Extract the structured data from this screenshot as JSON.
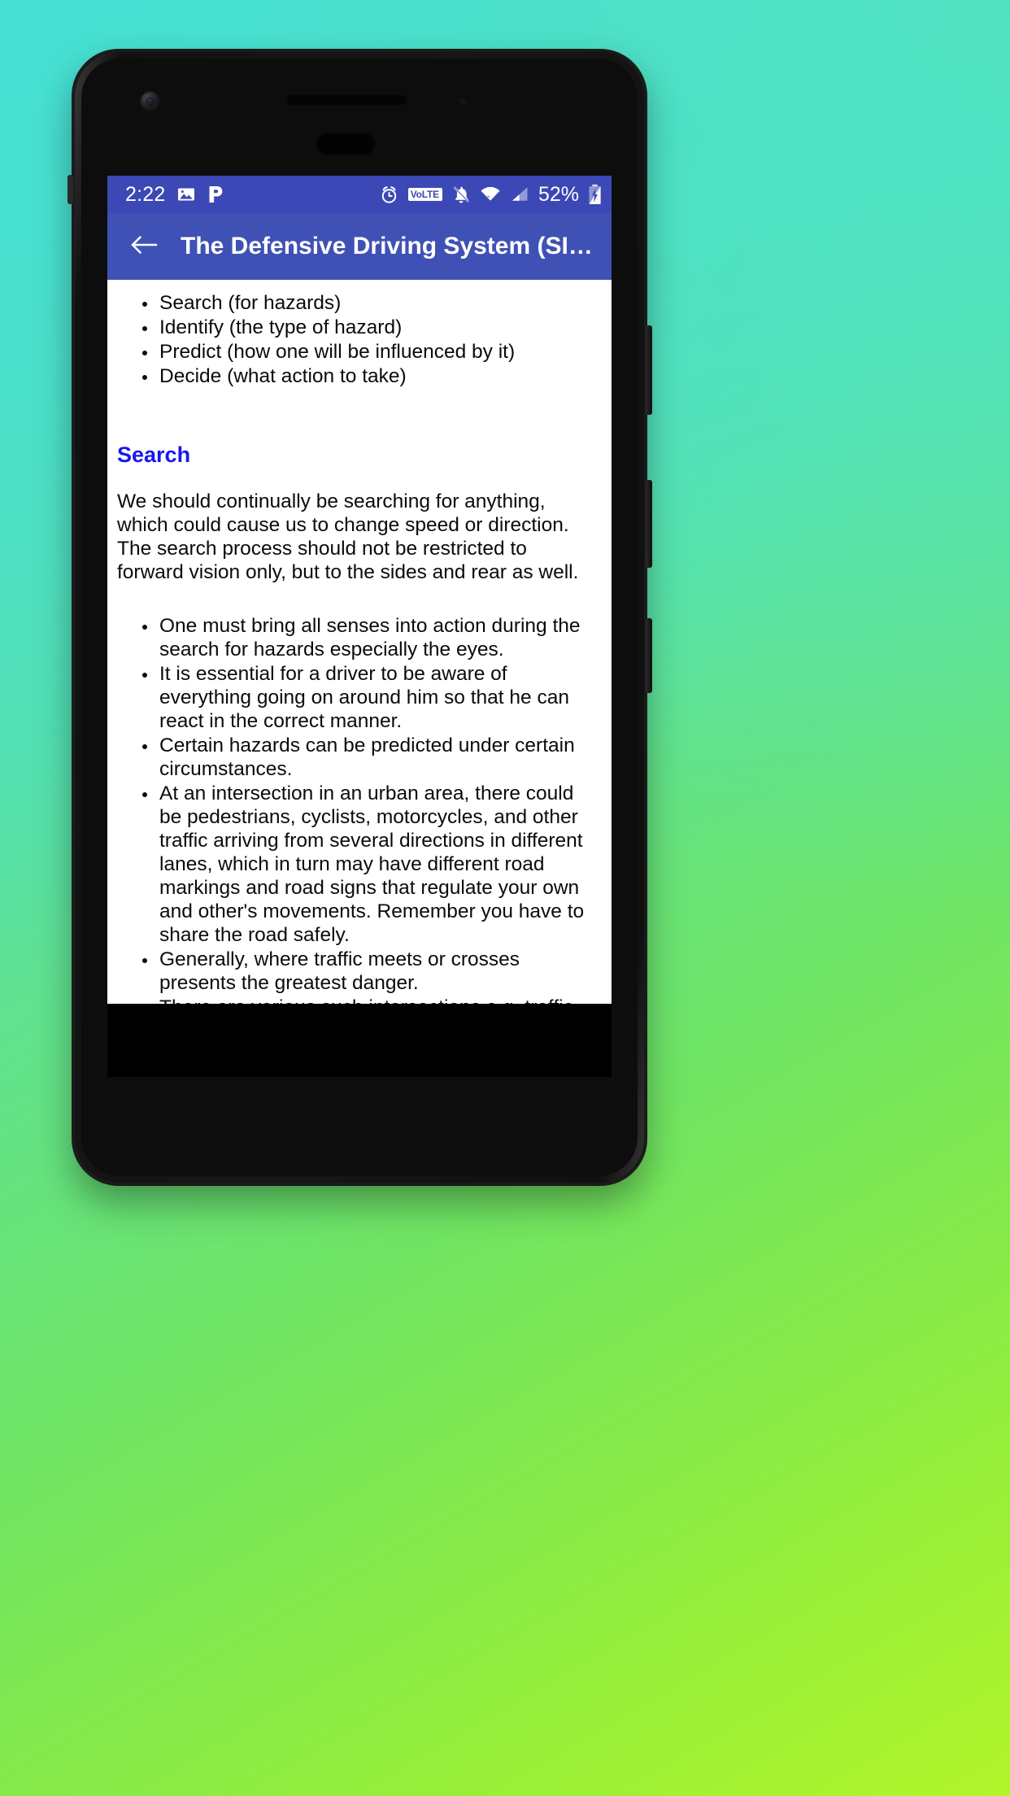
{
  "theme": {
    "status_bar_color": "#3b48b5",
    "app_bar_color": "#3f51b5",
    "heading_color": "#1616f0",
    "body_text_color": "#0b0b0b",
    "page_background": "#ffffff"
  },
  "status_bar": {
    "time": "2:22",
    "left_icons": [
      "photos-icon",
      "pandora-p-icon"
    ],
    "alarm_icon": "alarm-clock-icon",
    "volte_label": "VoLTE",
    "notification_icon": "bell-muted-icon",
    "wifi_icon": "wifi-icon",
    "signal_icon": "cellular-signal-icon",
    "battery_percent": "52%",
    "battery_icon": "battery-charging-icon"
  },
  "app_bar": {
    "back_icon": "arrow-left-icon",
    "title": "The Defensive Driving System (SI…"
  },
  "content": {
    "top_list": [
      "Search (for hazards)",
      "Identify (the type of hazard)",
      "Predict (how one will be influenced by it)",
      "Decide (what action to take)"
    ],
    "heading": "Search",
    "paragraph": "We should continually be searching for anything, which could cause us to change speed or direction. The search process should not be restricted to forward vision only, but to the sides and rear as well.",
    "bullets": [
      "One must bring all senses into action during the search for hazards especially the eyes.",
      "It is essential for a driver to be aware of everything going on around him so that he can react in the correct manner.",
      "Certain hazards can be predicted under certain circumstances.",
      "At an intersection in an urban area, there could be pedestrians, cyclists, motorcycles, and other traffic arriving from several directions in different lanes, which in turn may have different road markings and road signs that regulate your own and other's movements. Remember you have to share the road safely.",
      "Generally, where traffic meets or crosses presents the greatest danger.",
      "There are various such intersections e.g. traffic circles, on - and off-ramps on freeways, hidden entrances to houses, traffic light-controlled intersections, stop streets, junctions where one"
    ]
  }
}
